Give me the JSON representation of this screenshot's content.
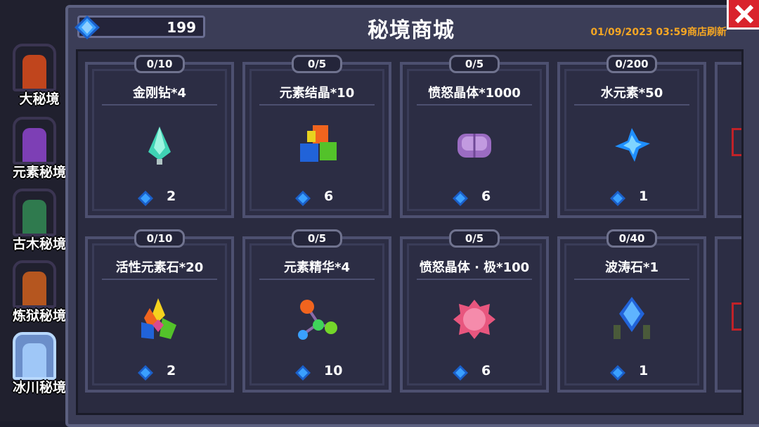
{
  "shop": {
    "title": "秘境商城",
    "gem_balance": "199",
    "refresh_text": "01/09/2023 03:59商店刷新"
  },
  "sidebar": {
    "items": [
      {
        "label": "大秘境",
        "color": "#c0451d"
      },
      {
        "label": "元素秘境",
        "color": "#7d3fb5"
      },
      {
        "label": "古木秘境",
        "color": "#2f7a4e"
      },
      {
        "label": "炼狱秘境",
        "color": "#b5561f"
      },
      {
        "label": "冰川秘境",
        "color": "#6fa7e8",
        "active": true
      }
    ]
  },
  "items": [
    {
      "stock": "0/10",
      "name": "金刚钻*4",
      "price": "2",
      "icon": "diamond-drill-icon"
    },
    {
      "stock": "0/5",
      "name": "元素结晶*10",
      "price": "6",
      "icon": "element-crystal-icon"
    },
    {
      "stock": "0/5",
      "name": "愤怒晶体*1000",
      "price": "6",
      "icon": "anger-crystal-icon"
    },
    {
      "stock": "0/200",
      "name": "水元素*50",
      "price": "1",
      "icon": "water-element-icon"
    },
    {
      "stock": "0/10",
      "name": "活性元素石*20",
      "price": "2",
      "icon": "active-element-stone-icon"
    },
    {
      "stock": "0/5",
      "name": "元素精华*4",
      "price": "10",
      "icon": "element-essence-icon"
    },
    {
      "stock": "0/5",
      "name": "愤怒晶体 · 极*100",
      "price": "6",
      "icon": "anger-crystal-extreme-icon"
    },
    {
      "stock": "0/40",
      "name": "波涛石*1",
      "price": "1",
      "icon": "wave-stone-icon"
    }
  ],
  "colors": {
    "gem": "#3aa0ff",
    "refresh": "#f5a623",
    "close": "#d9232c"
  }
}
